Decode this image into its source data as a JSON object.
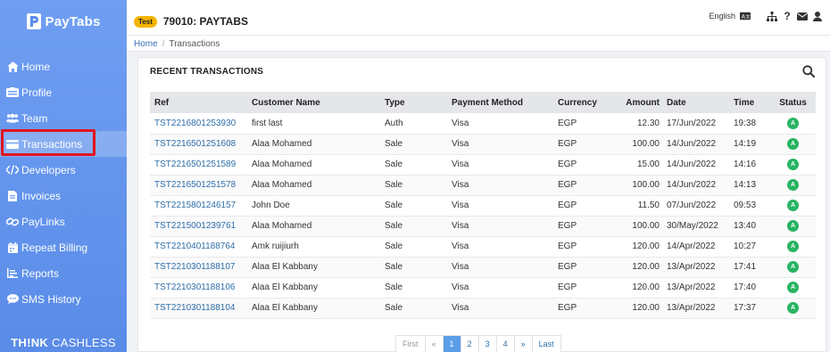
{
  "brand": {
    "name": "PayTabs",
    "tagline_bold": "TH!NK",
    "tagline_rest": " CASHLESS"
  },
  "sidebar": {
    "items": [
      {
        "label": "Home",
        "icon": "home-icon"
      },
      {
        "label": "Profile",
        "icon": "id-card-icon"
      },
      {
        "label": "Team",
        "icon": "users-icon"
      },
      {
        "label": "Transactions",
        "icon": "credit-card-icon",
        "active": true
      },
      {
        "label": "Developers",
        "icon": "code-icon"
      },
      {
        "label": "Invoices",
        "icon": "file-icon"
      },
      {
        "label": "PayLinks",
        "icon": "link-icon"
      },
      {
        "label": "Repeat Billing",
        "icon": "calendar-icon"
      },
      {
        "label": "Reports",
        "icon": "chart-icon"
      },
      {
        "label": "SMS History",
        "icon": "chat-icon"
      }
    ]
  },
  "header": {
    "env_badge": "Test",
    "merchant": "79010: PAYTABS",
    "language": "English",
    "breadcrumb": {
      "home": "Home",
      "current": "Transactions"
    }
  },
  "card": {
    "title": "RECENT TRANSACTIONS"
  },
  "table": {
    "headers": {
      "ref": "Ref",
      "customer": "Customer Name",
      "type": "Type",
      "method": "Payment Method",
      "currency": "Currency",
      "amount": "Amount",
      "date": "Date",
      "time": "Time",
      "status": "Status"
    },
    "rows": [
      {
        "ref": "TST2216801253930",
        "customer": "first last",
        "type": "Auth",
        "method": "Visa",
        "currency": "EGP",
        "amount": "12.30",
        "date": "17/Jun/2022",
        "time": "19:38",
        "status": "A"
      },
      {
        "ref": "TST2216501251608",
        "customer": "Alaa Mohamed",
        "type": "Sale",
        "method": "Visa",
        "currency": "EGP",
        "amount": "100.00",
        "date": "14/Jun/2022",
        "time": "14:19",
        "status": "A"
      },
      {
        "ref": "TST2216501251589",
        "customer": "Alaa Mohamed",
        "type": "Sale",
        "method": "Visa",
        "currency": "EGP",
        "amount": "15.00",
        "date": "14/Jun/2022",
        "time": "14:16",
        "status": "A"
      },
      {
        "ref": "TST2216501251578",
        "customer": "Alaa Mohamed",
        "type": "Sale",
        "method": "Visa",
        "currency": "EGP",
        "amount": "100.00",
        "date": "14/Jun/2022",
        "time": "14:13",
        "status": "A"
      },
      {
        "ref": "TST2215801246157",
        "customer": "John Doe",
        "type": "Sale",
        "method": "Visa",
        "currency": "EGP",
        "amount": "11.50",
        "date": "07/Jun/2022",
        "time": "09:53",
        "status": "A"
      },
      {
        "ref": "TST2215001239761",
        "customer": "Alaa Mohamed",
        "type": "Sale",
        "method": "Visa",
        "currency": "EGP",
        "amount": "100.00",
        "date": "30/May/2022",
        "time": "13:40",
        "status": "A"
      },
      {
        "ref": "TST2210401188764",
        "customer": "Amk ruijiurh",
        "type": "Sale",
        "method": "Visa",
        "currency": "EGP",
        "amount": "120.00",
        "date": "14/Apr/2022",
        "time": "10:27",
        "status": "A"
      },
      {
        "ref": "TST2210301188107",
        "customer": "Alaa El Kabbany",
        "type": "Sale",
        "method": "Visa",
        "currency": "EGP",
        "amount": "120.00",
        "date": "13/Apr/2022",
        "time": "17:41",
        "status": "A"
      },
      {
        "ref": "TST2210301188106",
        "customer": "Alaa El Kabbany",
        "type": "Sale",
        "method": "Visa",
        "currency": "EGP",
        "amount": "120.00",
        "date": "13/Apr/2022",
        "time": "17:40",
        "status": "A"
      },
      {
        "ref": "TST2210301188104",
        "customer": "Alaa El Kabbany",
        "type": "Sale",
        "method": "Visa",
        "currency": "EGP",
        "amount": "120.00",
        "date": "13/Apr/2022",
        "time": "17:37",
        "status": "A"
      }
    ]
  },
  "pagination": {
    "items": [
      {
        "label": "First",
        "state": "disabled"
      },
      {
        "label": "«",
        "state": "disabled"
      },
      {
        "label": "1",
        "state": "current"
      },
      {
        "label": "2",
        "state": "normal"
      },
      {
        "label": "3",
        "state": "normal"
      },
      {
        "label": "4",
        "state": "normal"
      },
      {
        "label": "»",
        "state": "normal"
      },
      {
        "label": "Last",
        "state": "normal"
      }
    ]
  },
  "colors": {
    "sidebar": "#6f9ef2",
    "accent_link": "#2d6da8",
    "status_approved": "#28b463",
    "highlight": "#e3131e",
    "test_badge": "#f4b400"
  }
}
